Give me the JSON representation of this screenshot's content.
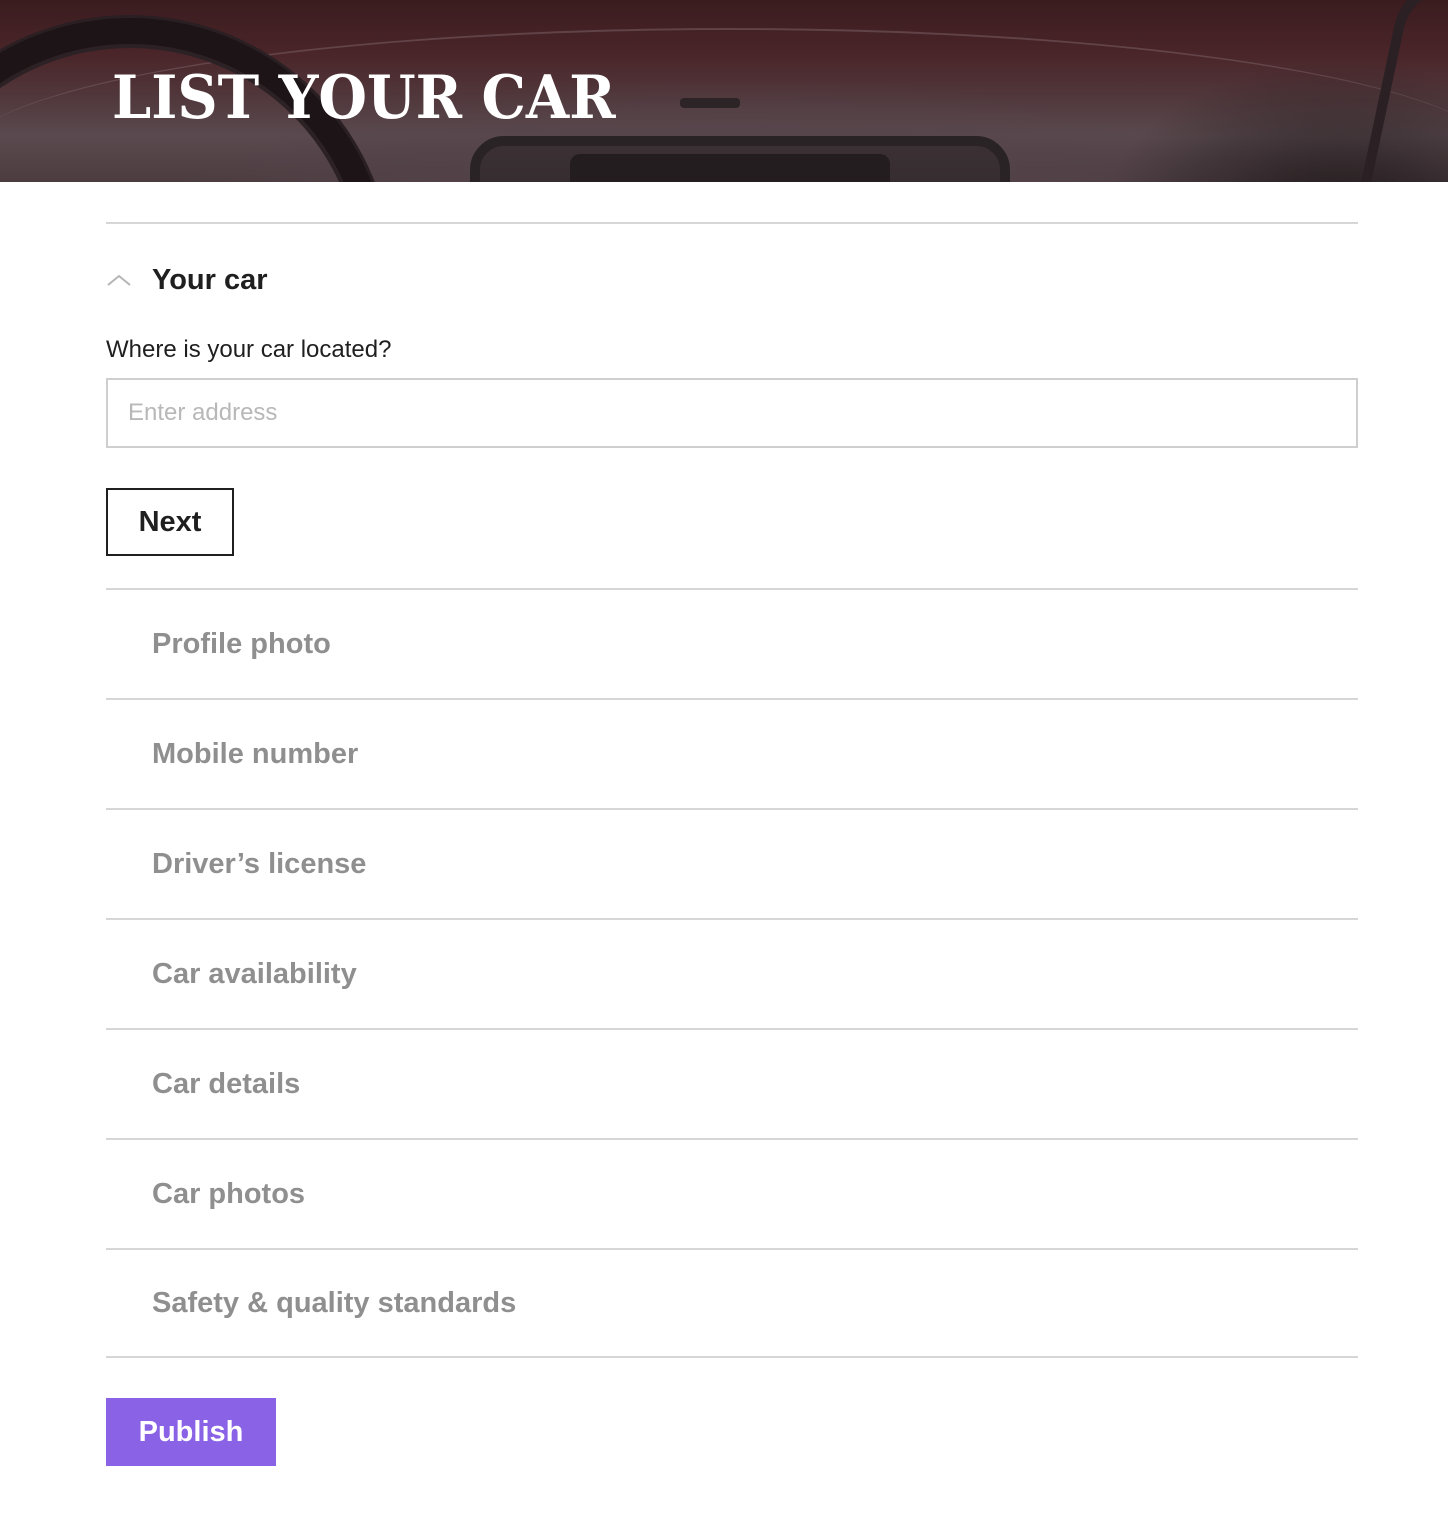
{
  "hero": {
    "title": "LIST YOUR CAR"
  },
  "open_section": {
    "title": "Your car",
    "icon": "chevron-up-icon",
    "field_label": "Where is your car located?",
    "address_input": {
      "value": "",
      "placeholder": "Enter address"
    },
    "next_label": "Next"
  },
  "collapsed_sections": [
    {
      "label": "Profile photo"
    },
    {
      "label": "Mobile number"
    },
    {
      "label": "Driver’s license"
    },
    {
      "label": "Car availability"
    },
    {
      "label": "Car details"
    },
    {
      "label": "Car photos"
    },
    {
      "label": "Safety & quality standards"
    }
  ],
  "publish_label": "Publish",
  "colors": {
    "accent": "#8a62e6",
    "muted_text": "#8f8f8f",
    "divider": "#d6d6d6"
  }
}
